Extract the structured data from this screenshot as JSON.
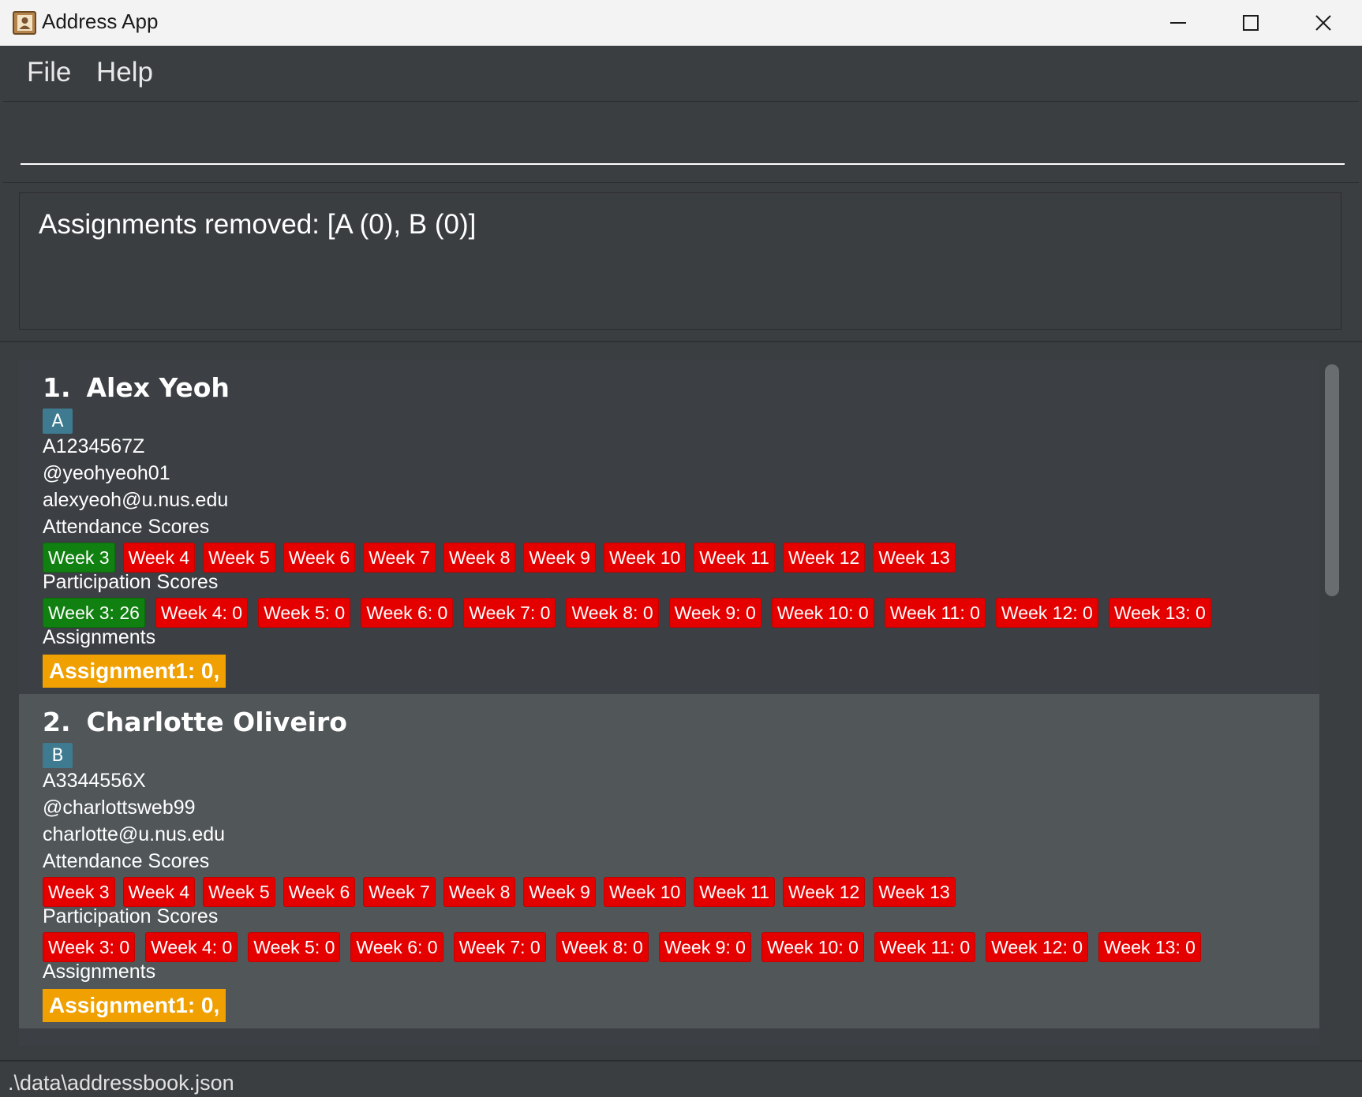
{
  "window": {
    "title": "Address App",
    "minimize_icon": "minimize-icon",
    "maximize_icon": "maximize-icon",
    "close_icon": "close-icon"
  },
  "menu": {
    "file": "File",
    "help": "Help"
  },
  "command": {
    "value": "",
    "placeholder": ""
  },
  "result": {
    "message": "Assignments removed: [A (0), B (0)]"
  },
  "persons": [
    {
      "index": "1.",
      "name": "Alex Yeoh",
      "group": "A",
      "student_id": "A1234567Z",
      "telegram": "@yeohyeoh01",
      "email": "alexyeoh@u.nus.edu",
      "attendance_label": "Attendance Scores",
      "attendance": [
        {
          "label": "Week 3",
          "status": "present"
        },
        {
          "label": "Week 4",
          "status": "absent"
        },
        {
          "label": "Week 5",
          "status": "absent"
        },
        {
          "label": "Week 6",
          "status": "absent"
        },
        {
          "label": "Week 7",
          "status": "absent"
        },
        {
          "label": "Week 8",
          "status": "absent"
        },
        {
          "label": "Week 9",
          "status": "absent"
        },
        {
          "label": "Week 10",
          "status": "absent"
        },
        {
          "label": "Week 11",
          "status": "absent"
        },
        {
          "label": "Week 12",
          "status": "absent"
        },
        {
          "label": "Week 13",
          "status": "absent"
        }
      ],
      "participation_label": "Participation Scores",
      "participation": [
        {
          "label": "Week 3: 26",
          "status": "present"
        },
        {
          "label": "Week 4: 0",
          "status": "absent"
        },
        {
          "label": "Week 5: 0",
          "status": "absent"
        },
        {
          "label": "Week 6: 0",
          "status": "absent"
        },
        {
          "label": "Week 7: 0",
          "status": "absent"
        },
        {
          "label": "Week 8: 0",
          "status": "absent"
        },
        {
          "label": "Week 9: 0",
          "status": "absent"
        },
        {
          "label": "Week 10: 0",
          "status": "absent"
        },
        {
          "label": "Week 11: 0",
          "status": "absent"
        },
        {
          "label": "Week 12: 0",
          "status": "absent"
        },
        {
          "label": "Week 13: 0",
          "status": "absent"
        }
      ],
      "assignments_label": "Assignments",
      "assignment": "Assignment1: 0,"
    },
    {
      "index": "2.",
      "name": "Charlotte Oliveiro",
      "group": "B",
      "student_id": "A3344556X",
      "telegram": "@charlottsweb99",
      "email": "charlotte@u.nus.edu",
      "attendance_label": "Attendance Scores",
      "attendance": [
        {
          "label": "Week 3",
          "status": "absent"
        },
        {
          "label": "Week 4",
          "status": "absent"
        },
        {
          "label": "Week 5",
          "status": "absent"
        },
        {
          "label": "Week 6",
          "status": "absent"
        },
        {
          "label": "Week 7",
          "status": "absent"
        },
        {
          "label": "Week 8",
          "status": "absent"
        },
        {
          "label": "Week 9",
          "status": "absent"
        },
        {
          "label": "Week 10",
          "status": "absent"
        },
        {
          "label": "Week 11",
          "status": "absent"
        },
        {
          "label": "Week 12",
          "status": "absent"
        },
        {
          "label": "Week 13",
          "status": "absent"
        }
      ],
      "participation_label": "Participation Scores",
      "participation": [
        {
          "label": "Week 3: 0",
          "status": "absent"
        },
        {
          "label": "Week 4: 0",
          "status": "absent"
        },
        {
          "label": "Week 5: 0",
          "status": "absent"
        },
        {
          "label": "Week 6: 0",
          "status": "absent"
        },
        {
          "label": "Week 7: 0",
          "status": "absent"
        },
        {
          "label": "Week 8: 0",
          "status": "absent"
        },
        {
          "label": "Week 9: 0",
          "status": "absent"
        },
        {
          "label": "Week 10: 0",
          "status": "absent"
        },
        {
          "label": "Week 11: 0",
          "status": "absent"
        },
        {
          "label": "Week 12: 0",
          "status": "absent"
        },
        {
          "label": "Week 13: 0",
          "status": "absent"
        }
      ],
      "assignments_label": "Assignments",
      "assignment": "Assignment1: 0,"
    }
  ],
  "status_bar": {
    "path": ".\\data\\addressbook.json"
  },
  "colors": {
    "background": "#3b3e41",
    "present": "#108010",
    "absent": "#e50000",
    "assignment": "#f0a000",
    "group_tag": "#3e7b91"
  }
}
